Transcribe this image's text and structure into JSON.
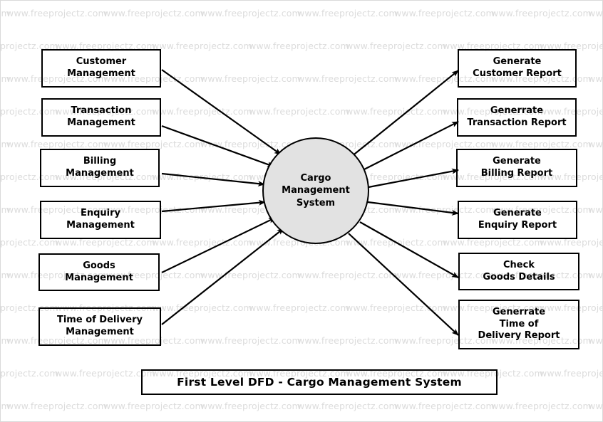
{
  "diagram": {
    "title": "First Level DFD - Cargo Management System",
    "process": {
      "label": "Cargo\nManagement\nSystem",
      "fill": "#e2e2e2",
      "stroke": "#000000"
    },
    "inputs": [
      {
        "label": "Customer\nManagement"
      },
      {
        "label": "Transaction\nManagement"
      },
      {
        "label": "Billing\nManagement"
      },
      {
        "label": "Enquiry\nManagement"
      },
      {
        "label": "Goods\nManagement"
      },
      {
        "label": "Time of Delivery\nManagement"
      }
    ],
    "outputs": [
      {
        "label": "Generate\nCustomer Report"
      },
      {
        "label": "Generrate\nTransaction Report"
      },
      {
        "label": "Generate\nBilling Report"
      },
      {
        "label": "Generate\nEnquiry Report"
      },
      {
        "label": "Check\nGoods Details"
      },
      {
        "label": "Generrate\nTime of\nDelivery Report"
      }
    ]
  },
  "watermark": {
    "text": "www.freeprojectz.com",
    "color": "#dcdcdc"
  }
}
